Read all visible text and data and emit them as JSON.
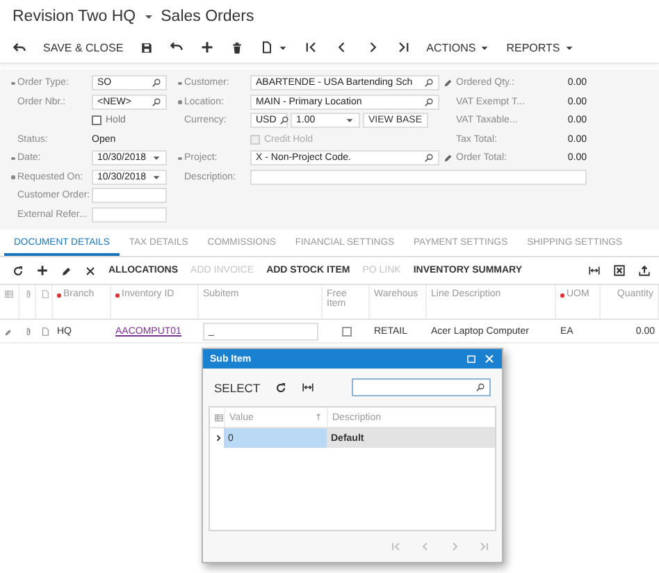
{
  "header": {
    "company": "Revision Two HQ",
    "screen": "Sales Orders"
  },
  "toolbar": {
    "save_close": "SAVE & CLOSE",
    "menus": [
      "ACTIONS",
      "REPORTS"
    ]
  },
  "form": {
    "column_1": [
      {
        "kind": "lookup",
        "label": "Order Type:",
        "required": true,
        "value": "SO"
      },
      {
        "kind": "lookup",
        "label": "Order Nbr.:",
        "required": false,
        "value": "<NEW>"
      },
      {
        "kind": "checkbox",
        "label": "Hold",
        "checked": false,
        "disabled": false
      },
      {
        "kind": "text",
        "label": "Status:",
        "required": false,
        "value": "Open"
      },
      {
        "kind": "date",
        "label": "Date:",
        "required": true,
        "value": "10/30/2018"
      },
      {
        "kind": "date",
        "label": "Requested On:",
        "required": true,
        "value": "10/30/2018"
      },
      {
        "kind": "input",
        "label": "Customer Order:",
        "required": false
      },
      {
        "kind": "input",
        "label": "External Refer...",
        "required": false
      }
    ],
    "column_2": [
      {
        "kind": "lookup",
        "label": "Customer:",
        "required": true,
        "value": "ABARTENDE - USA Bartending Sch",
        "editable": true
      },
      {
        "kind": "lookup",
        "label": "Location:",
        "required": true,
        "value": "MAIN - Primary Location",
        "editable": false
      },
      {
        "kind": "currency",
        "label": "Currency:",
        "required": false,
        "value": "USD",
        "rate": "1.00",
        "button": "VIEW BASE"
      },
      {
        "kind": "checkbox",
        "label": "Credit Hold",
        "checked": false,
        "disabled": true
      },
      {
        "kind": "lookup",
        "label": "Project:",
        "required": true,
        "value": "X - Non-Project Code.",
        "editable": true
      },
      {
        "kind": "input",
        "label": "Description:",
        "required": false
      }
    ],
    "totals": [
      {
        "label": "Ordered Qty.:",
        "value": "0.00"
      },
      {
        "label": "VAT Exempt T...",
        "value": "0.00"
      },
      {
        "label": "VAT Taxable...",
        "value": "0.00"
      },
      {
        "label": "Tax Total:",
        "value": "0.00"
      },
      {
        "label": "Order Total:",
        "value": "0.00"
      }
    ]
  },
  "tabs": [
    {
      "label": "DOCUMENT DETAILS",
      "selected": true
    },
    {
      "label": "TAX DETAILS",
      "selected": false
    },
    {
      "label": "COMMISSIONS",
      "selected": false
    },
    {
      "label": "FINANCIAL SETTINGS",
      "selected": false
    },
    {
      "label": "PAYMENT SETTINGS",
      "selected": false
    },
    {
      "label": "SHIPPING SETTINGS",
      "selected": false
    }
  ],
  "grid_toolbar": [
    {
      "label": "ALLOCATIONS",
      "disabled": false
    },
    {
      "label": "ADD INVOICE",
      "disabled": true
    },
    {
      "label": "ADD STOCK ITEM",
      "disabled": false
    },
    {
      "label": "PO LINK",
      "disabled": true
    },
    {
      "label": "INVENTORY SUMMARY",
      "disabled": false
    }
  ],
  "grid": {
    "columns": [
      {
        "label": "Branch",
        "required": true
      },
      {
        "label": "Inventory ID",
        "required": true
      },
      {
        "label": "Subitem",
        "required": false
      },
      {
        "label": "Free Item",
        "required": false
      },
      {
        "label": "Warehous",
        "required": false
      },
      {
        "label": "Line Description",
        "required": false
      },
      {
        "label": "UOM",
        "required": true
      },
      {
        "label": "Quantity",
        "required": false
      }
    ],
    "rows": [
      {
        "branch": "HQ",
        "inventory_id": "AACOMPUT01",
        "subitem": "_",
        "free_item": false,
        "warehouse": "RETAIL",
        "line_description": "Acer Laptop Computer",
        "uom": "EA",
        "quantity": "0.00"
      }
    ]
  },
  "dialog": {
    "title": "Sub Item",
    "select": "SELECT",
    "columns": [
      {
        "label": "Value",
        "sorted": true
      },
      {
        "label": "Description",
        "sorted": false
      }
    ],
    "rows": [
      {
        "value": "0",
        "description": "Default",
        "selected": true
      }
    ]
  }
}
